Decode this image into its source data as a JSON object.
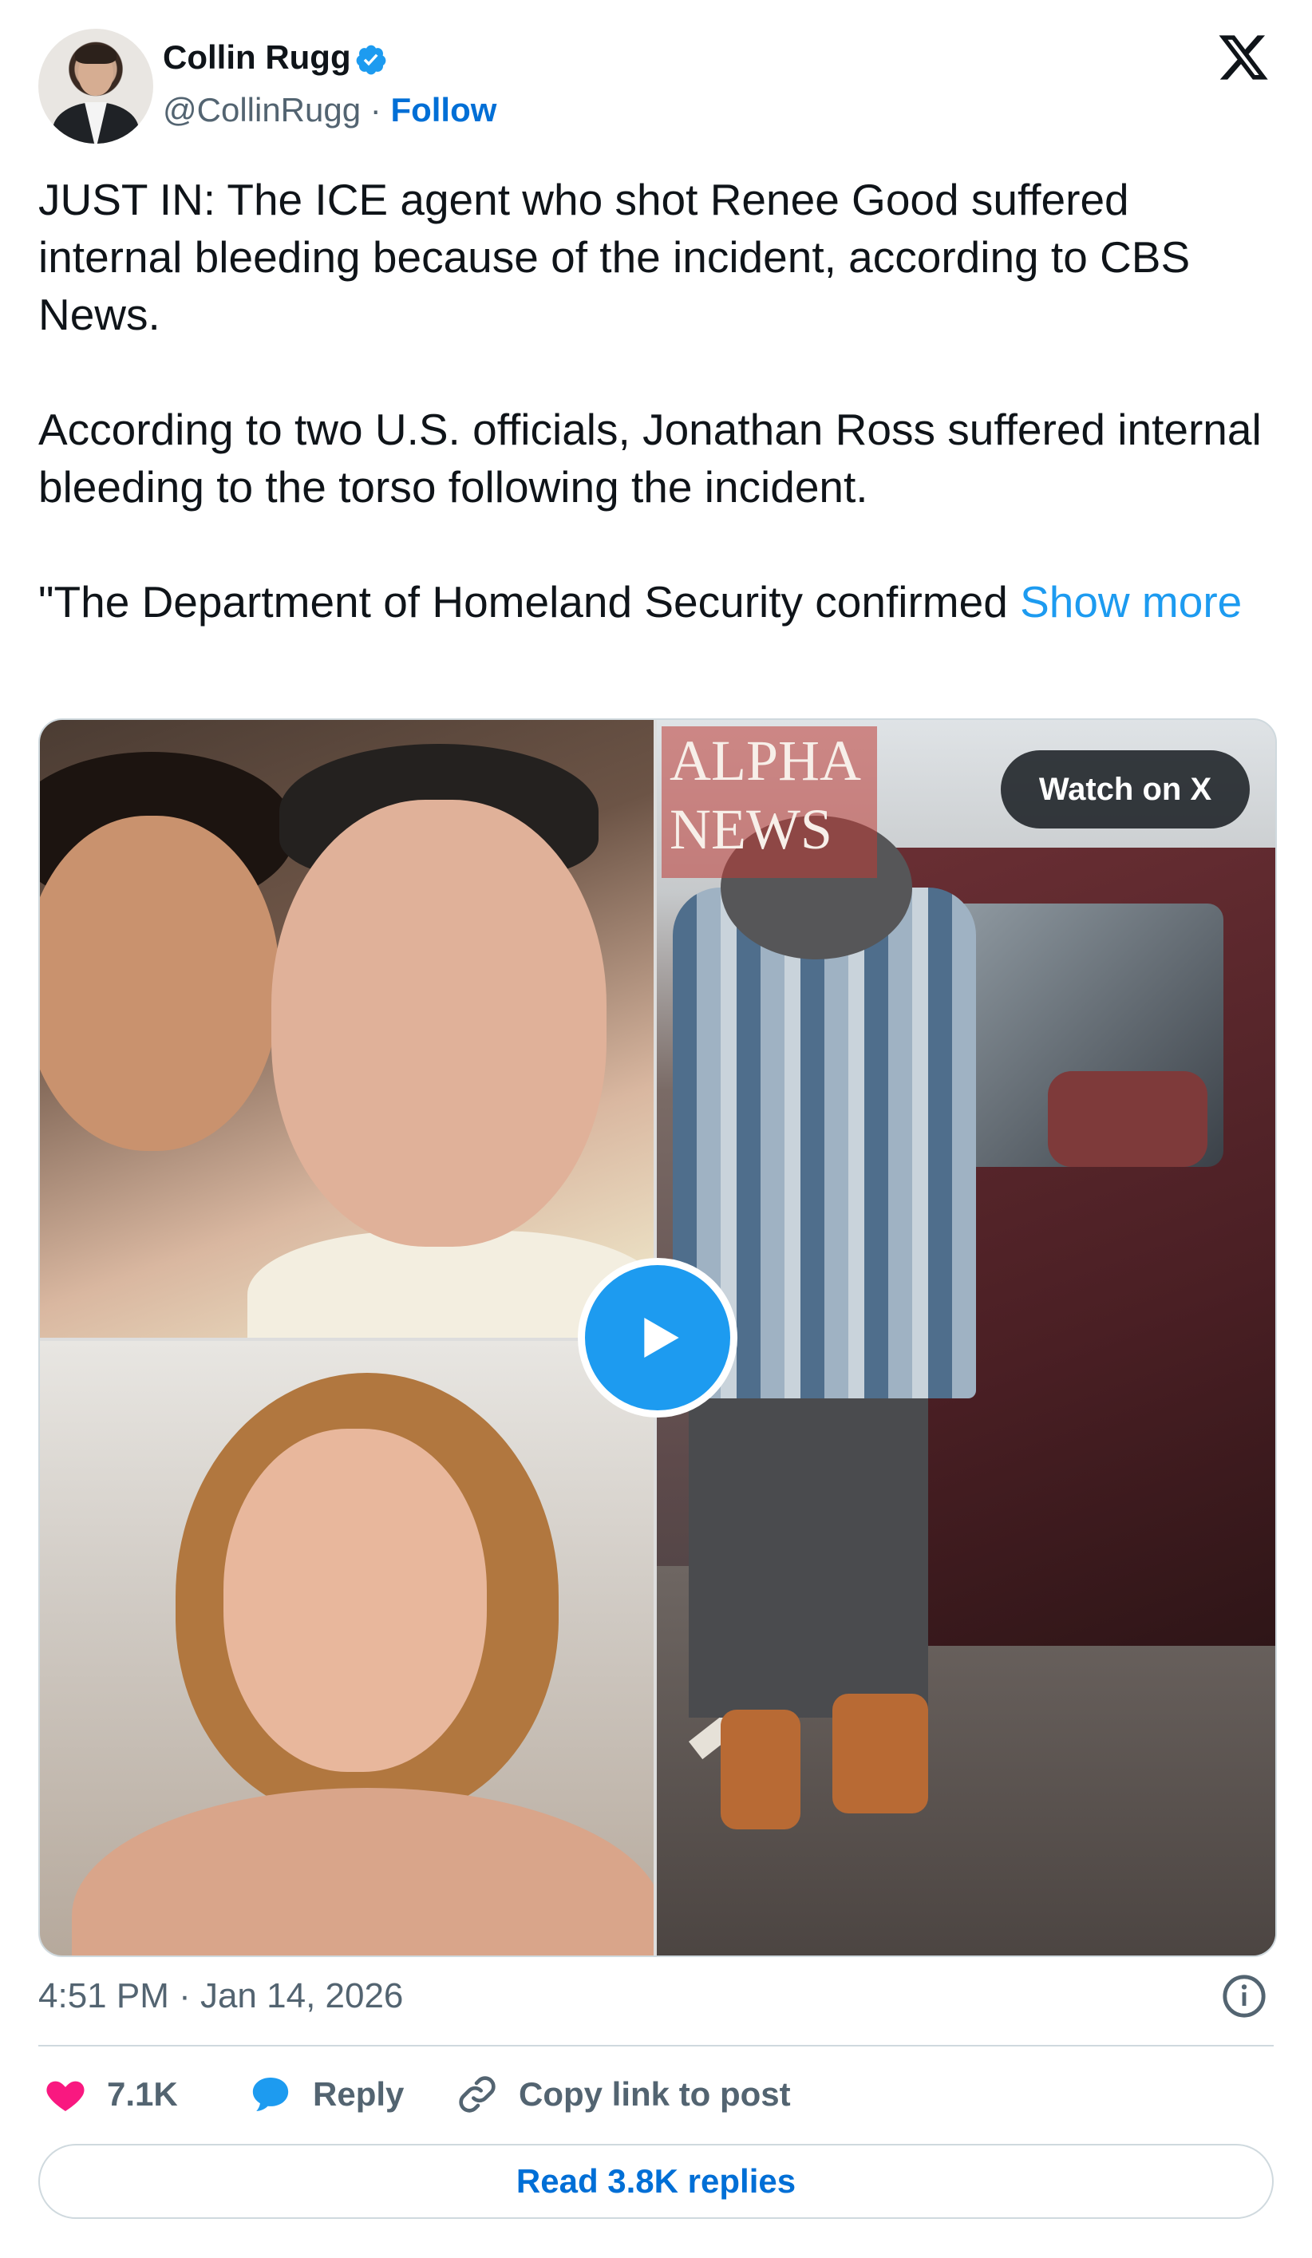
{
  "author": {
    "name": "Collin Rugg",
    "handle": "@CollinRugg",
    "separator": "·",
    "follow_label": "Follow"
  },
  "tweet": {
    "text": "JUST IN: The ICE agent who shot Renee Good suffered internal bleeding because of the incident, according to CBS News.\n\nAccording to two U.S. officials, Jonathan Ross suffered internal bleeding to the torso following the incident.\n\n\"The Department of Homeland Security confirmed ",
    "show_more": "Show more",
    "timestamp": "4:51 PM · Jan 14, 2026"
  },
  "media": {
    "watermark_line1": "ALPHA",
    "watermark_line2": "NEWS",
    "watch_label": "Watch on X"
  },
  "actions": {
    "likes": "7.1K",
    "reply_label": "Reply",
    "copy_label": "Copy link to post",
    "read_replies": "Read 3.8K replies"
  },
  "colors": {
    "accent": "#1d9bf0",
    "link": "#006fd6",
    "like": "#f91880",
    "muted": "#536471"
  },
  "icons": [
    "verified-badge-icon",
    "x-logo-icon",
    "play-icon",
    "info-icon",
    "heart-icon",
    "reply-bubble-icon",
    "link-icon"
  ]
}
